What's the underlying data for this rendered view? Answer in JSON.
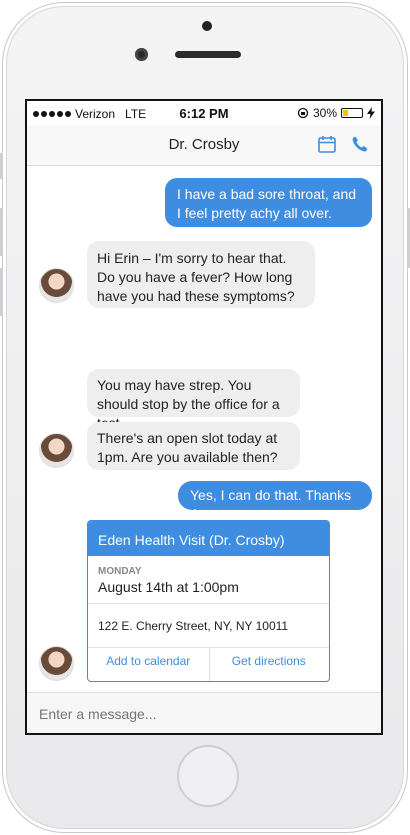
{
  "status": {
    "carrier": "Verizon",
    "network": "LTE",
    "time": "6:12 PM",
    "battery": "30%",
    "battery_level": 0.3
  },
  "nav": {
    "title": "Dr. Crosby"
  },
  "messages": [
    {
      "from": "user",
      "text": "I have a bad sore throat, and I feel pretty achy all over."
    },
    {
      "from": "doctor",
      "text": "Hi Erin – I'm sorry to hear that. Do you have a fever? How long have you had these symptoms?"
    },
    {
      "from": "doctor",
      "text": "You may have strep. You should stop by the office for a test."
    },
    {
      "from": "doctor",
      "text": "There's an open slot today at 1pm. Are you available then?"
    },
    {
      "from": "user",
      "text": "Yes, I can do that. Thanks :)"
    }
  ],
  "appointment": {
    "title": "Eden Health Visit (Dr. Crosby)",
    "day": "MONDAY",
    "datetime": "August 14th at 1:00pm",
    "address": "122 E. Cherry Street, NY, NY 10011",
    "add_calendar": "Add to calendar",
    "directions": "Get directions"
  },
  "composer": {
    "placeholder": "Enter a message..."
  },
  "colors": {
    "accent": "#3f8de0",
    "incoming": "#eeeeee"
  }
}
